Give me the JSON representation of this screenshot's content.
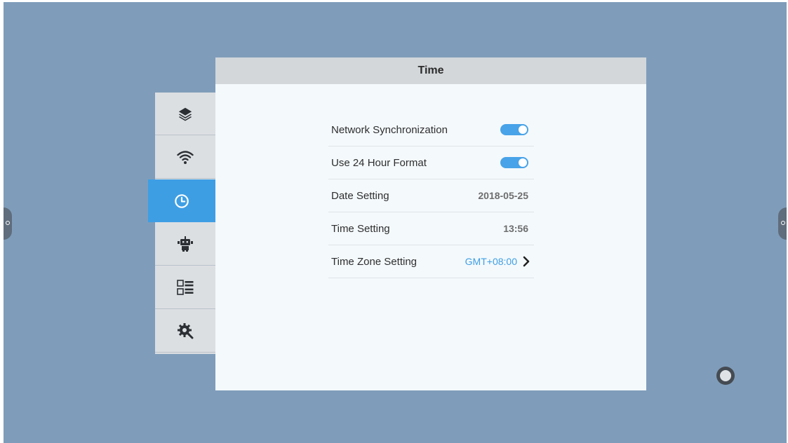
{
  "panel": {
    "title": "Time"
  },
  "sidebar": {
    "items": [
      {
        "icon": "layers-icon",
        "active": false
      },
      {
        "icon": "wifi-icon",
        "active": false
      },
      {
        "icon": "clock-icon",
        "active": true
      },
      {
        "icon": "robot-icon",
        "active": false
      },
      {
        "icon": "app-list-icon",
        "active": false
      },
      {
        "icon": "gear-wrench-icon",
        "active": false
      }
    ]
  },
  "settings": {
    "network_sync": {
      "label": "Network Synchronization",
      "enabled": true
    },
    "hour24": {
      "label": "Use 24 Hour Format",
      "enabled": true
    },
    "date": {
      "label": "Date Setting",
      "value": "2018-05-25"
    },
    "time": {
      "label": "Time Setting",
      "value": "13:56"
    },
    "timezone": {
      "label": "Time Zone Setting",
      "value": "GMT+08:00"
    }
  },
  "colors": {
    "accent": "#3e9ee4",
    "desktop": "#7f9dba",
    "panel_bg": "#f4f9fc",
    "header_bg": "#d3d7da"
  }
}
